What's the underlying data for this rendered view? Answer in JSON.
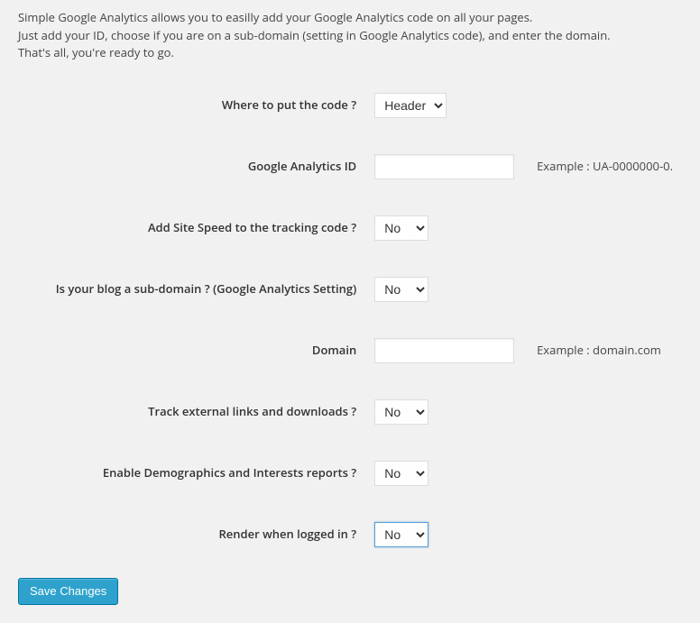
{
  "intro": {
    "line1": "Simple Google Analytics allows you to easilly add your Google Analytics code on all your pages.",
    "line2": "Just add your ID, choose if you are on a sub-domain (setting in Google Analytics code), and enter the domain.",
    "line3": "That's all, you're ready to go."
  },
  "fields": {
    "where_label": "Where to put the code ?",
    "where_value": "Header",
    "ga_id_label": "Google Analytics ID",
    "ga_id_value": "",
    "ga_id_hint": "Example : UA-0000000-0.",
    "site_speed_label": "Add Site Speed to the tracking code ?",
    "site_speed_value": "No",
    "subdomain_label": "Is your blog a sub-domain ? (Google Analytics Setting)",
    "subdomain_value": "No",
    "domain_label": "Domain",
    "domain_value": "",
    "domain_hint": "Example : domain.com",
    "track_ext_label": "Track external links and downloads ?",
    "track_ext_value": "No",
    "demographics_label": "Enable Demographics and Interests reports ?",
    "demographics_value": "No",
    "render_logged_label": "Render when logged in ?",
    "render_logged_value": "No"
  },
  "buttons": {
    "save": "Save Changes"
  }
}
